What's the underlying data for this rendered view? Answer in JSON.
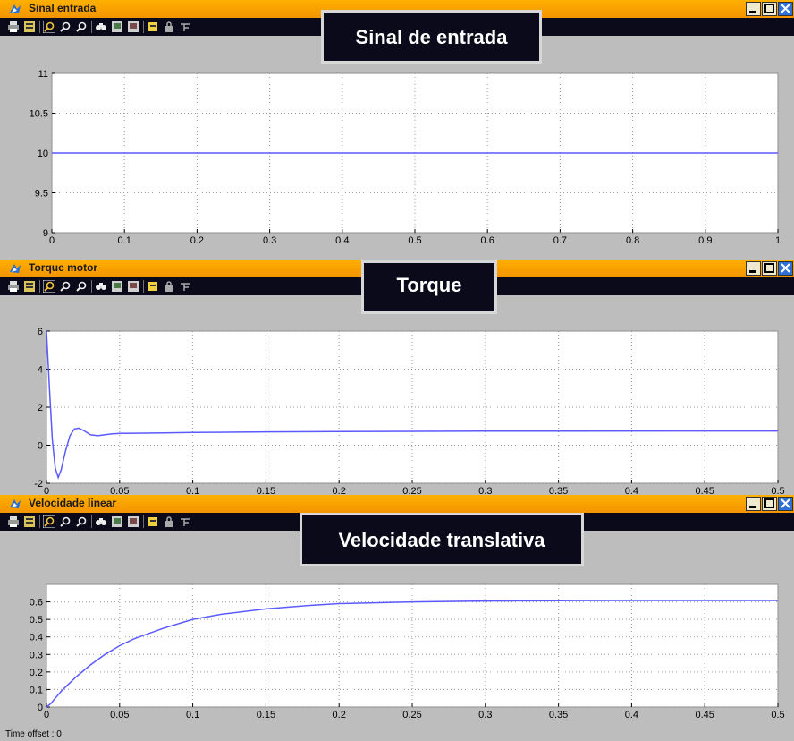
{
  "windows": [
    {
      "id": "sinal",
      "title": "Sinal entrada",
      "annotation": "Sinal de entrada",
      "chart_data": {
        "type": "line",
        "x_ticks": [
          "0",
          "0.1",
          "0.2",
          "0.3",
          "0.4",
          "0.5",
          "0.6",
          "0.7",
          "0.8",
          "0.9",
          "1"
        ],
        "y_ticks": [
          "9",
          "9.5",
          "10",
          "10.5",
          "11"
        ],
        "xlim": [
          0,
          1
        ],
        "ylim": [
          9,
          11
        ],
        "grid": true,
        "series": [
          {
            "color": "#5a5aff",
            "x": [
              0,
              1
            ],
            "y": [
              10,
              10
            ]
          }
        ]
      }
    },
    {
      "id": "torque",
      "title": "Torque motor",
      "annotation": "Torque",
      "chart_data": {
        "type": "line",
        "x_ticks": [
          "0",
          "0.05",
          "0.1",
          "0.15",
          "0.2",
          "0.25",
          "0.3",
          "0.35",
          "0.4",
          "0.45",
          "0.5"
        ],
        "y_ticks": [
          "-2",
          "0",
          "2",
          "4",
          "6"
        ],
        "xlim": [
          0,
          0.5
        ],
        "ylim": [
          -2,
          6
        ],
        "grid": true,
        "series": [
          {
            "color": "#5a5aff",
            "x": [
              0,
              0.002,
              0.004,
              0.006,
              0.008,
              0.01,
              0.013,
              0.016,
              0.019,
              0.022,
              0.026,
              0.03,
              0.035,
              0.04,
              0.045,
              0.05,
              0.06,
              0.08,
              0.1,
              0.15,
              0.2,
              0.3,
              0.5
            ],
            "y": [
              6,
              3.0,
              0.3,
              -1.2,
              -1.7,
              -1.3,
              -0.3,
              0.5,
              0.85,
              0.9,
              0.75,
              0.55,
              0.5,
              0.55,
              0.6,
              0.62,
              0.63,
              0.65,
              0.67,
              0.7,
              0.72,
              0.74,
              0.75
            ]
          }
        ]
      }
    },
    {
      "id": "velocidade",
      "title": "Velocidade linear",
      "annotation": "Velocidade translativa",
      "chart_data": {
        "type": "line",
        "x_ticks": [
          "0",
          "0.05",
          "0.1",
          "0.15",
          "0.2",
          "0.25",
          "0.3",
          "0.35",
          "0.4",
          "0.45",
          "0.5"
        ],
        "y_ticks": [
          "0",
          "0.1",
          "0.2",
          "0.3",
          "0.4",
          "0.5",
          "0.6"
        ],
        "xlim": [
          0,
          0.5
        ],
        "ylim": [
          0,
          0.7
        ],
        "grid": true,
        "series": [
          {
            "color": "#5a5aff",
            "x": [
              0,
              0.003,
              0.006,
              0.01,
              0.015,
              0.02,
              0.03,
              0.04,
              0.05,
              0.06,
              0.08,
              0.1,
              0.12,
              0.15,
              0.18,
              0.2,
              0.25,
              0.3,
              0.35,
              0.4,
              0.45,
              0.5
            ],
            "y": [
              0,
              0.02,
              0.05,
              0.09,
              0.13,
              0.17,
              0.24,
              0.3,
              0.35,
              0.39,
              0.45,
              0.5,
              0.53,
              0.56,
              0.58,
              0.59,
              0.6,
              0.605,
              0.607,
              0.608,
              0.608,
              0.608
            ]
          }
        ]
      }
    }
  ],
  "status": {
    "time_offset_label": "Time offset :",
    "time_offset_value": "0"
  }
}
